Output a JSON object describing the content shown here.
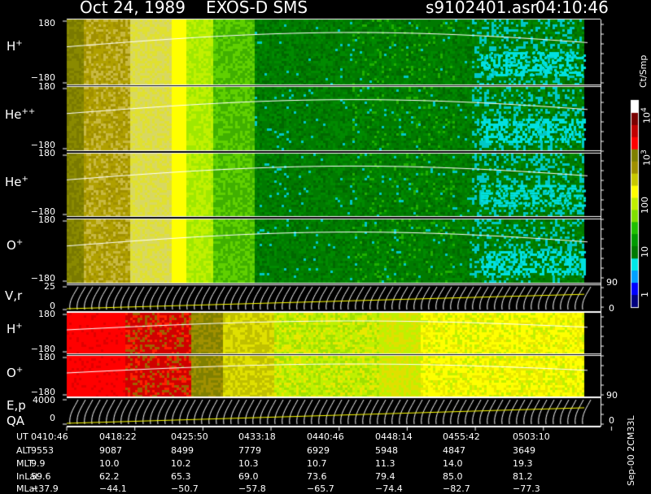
{
  "header": {
    "date": "Oct 24, 1989",
    "instrument": "EXOS-D SMS",
    "file": "s9102401.asr",
    "time": "04:10:46"
  },
  "side": {
    "unit": "Ct/Smp",
    "stamp": "Sep-00 2CM33L"
  },
  "colorbar": {
    "labels": [
      {
        "value": "10",
        "sup": "4"
      },
      {
        "value": "10",
        "sup": "3"
      },
      {
        "value": "100",
        "sup": ""
      },
      {
        "value": "10",
        "sup": ""
      },
      {
        "value": "1",
        "sup": ""
      }
    ]
  },
  "panels": [
    {
      "label": "H",
      "sup": "+",
      "ticks": [
        "180",
        "−180"
      ]
    },
    {
      "label": "He",
      "sup": "++",
      "ticks": [
        "180",
        "−180"
      ]
    },
    {
      "label": "He",
      "sup": "+",
      "ticks": [
        "180",
        "−180"
      ]
    },
    {
      "label": "O",
      "sup": "+",
      "ticks": [
        "180",
        "−180"
      ]
    },
    {
      "label": "V,r",
      "sup": "",
      "ticks": [
        "25",
        "0"
      ],
      "right_ticks": [
        "90",
        "0"
      ]
    },
    {
      "label": "H",
      "sup": "+",
      "ticks": [
        "180",
        "−180"
      ]
    },
    {
      "label": "O",
      "sup": "+",
      "ticks": [
        "180",
        "−180"
      ]
    },
    {
      "label": "E,p",
      "sup": "",
      "label2": "QA",
      "ticks": [
        "4000",
        "0"
      ],
      "right_ticks": [
        "90",
        "0"
      ]
    }
  ],
  "chart_data": {
    "type": "heatmap",
    "title": "Oct 24, 1989   EXOS-D SMS",
    "colorbar_unit": "Ct/Smp",
    "colorbar_scale": "log",
    "colorbar_range": [
      1,
      10000
    ],
    "colors": [
      "#00007f",
      "#0000ff",
      "#00a0ff",
      "#00e8e8",
      "#007a00",
      "#009a00",
      "#20c000",
      "#80e000",
      "#c0f000",
      "#ffff00",
      "#c8c800",
      "#a09000",
      "#808000",
      "#ff0000",
      "#c00000",
      "#7a0000",
      "#ffffff"
    ],
    "time_axis": [
      "04:10:46",
      "04:18:22",
      "04:25:50",
      "04:33:18",
      "04:40:46",
      "04:48:14",
      "04:55:42",
      "05:03:10"
    ]
  },
  "table": {
    "rows": [
      {
        "name": "UT",
        "values": [
          "0410:46",
          "0418:22",
          "0425:50",
          "0433:18",
          "0440:46",
          "0448:14",
          "0455:42",
          "0503:10"
        ]
      },
      {
        "name": "ALT",
        "values": [
          "9553",
          "9087",
          "8499",
          "7779",
          "6929",
          "5948",
          "4847",
          "3649"
        ]
      },
      {
        "name": "MLT",
        "values": [
          "9.9",
          "10.0",
          "10.2",
          "10.3",
          "10.7",
          "11.3",
          "14.0",
          "19.3"
        ]
      },
      {
        "name": "InLat",
        "values": [
          "59.6",
          "62.2",
          "65.3",
          "69.0",
          "73.6",
          "79.4",
          "85.0",
          "81.2"
        ]
      },
      {
        "name": "MLat",
        "values": [
          "−37.9",
          "−44.1",
          "−50.7",
          "−57.8",
          "−65.7",
          "−74.4",
          "−82.7",
          "−77.3"
        ]
      }
    ]
  }
}
